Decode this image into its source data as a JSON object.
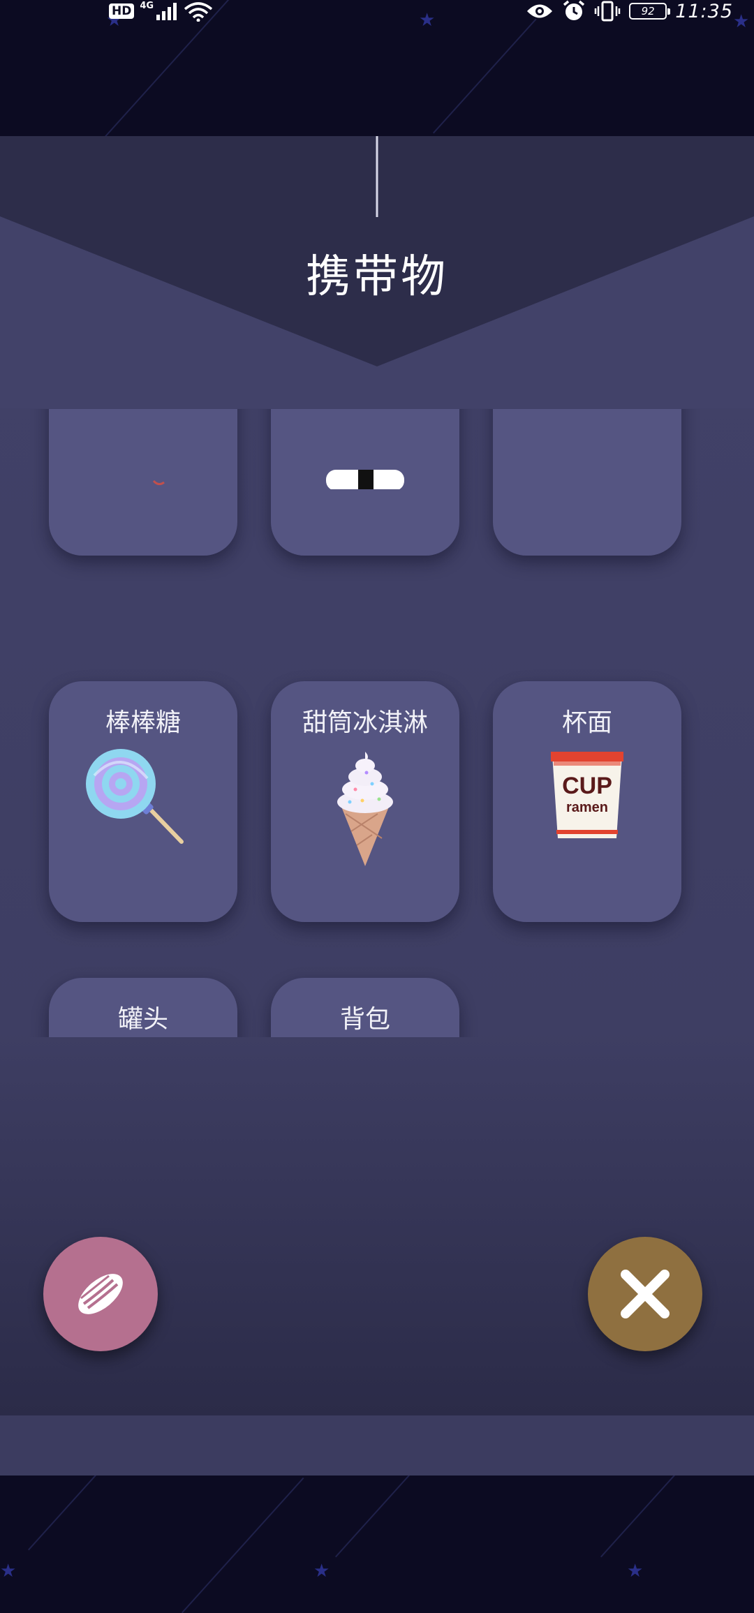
{
  "status_bar": {
    "hd_badge": "HD",
    "network": "4G",
    "battery": "92",
    "time": "11:35"
  },
  "modal": {
    "title": "携带物"
  },
  "items": [
    {
      "label": "",
      "icon": "partial-item-icon"
    },
    {
      "label": "",
      "icon": "partial-item-icon"
    },
    {
      "label": "",
      "icon": "partial-item-icon"
    },
    {
      "label": "棒棒糖",
      "icon": "lollipop-icon"
    },
    {
      "label": "甜筒冰淇淋",
      "icon": "ice-cream-cone-icon"
    },
    {
      "label": "杯面",
      "icon": "cup-ramen-icon"
    },
    {
      "label": "罐头",
      "icon": "canned-fish-icon"
    },
    {
      "label": "背包",
      "icon": "handbag-icon"
    }
  ],
  "cup_text": {
    "line1": "CUP",
    "line2": "ramen"
  },
  "actions": {
    "left": {
      "icon": "seed-icon",
      "color": "#b5708f"
    },
    "right": {
      "icon": "close-icon",
      "color": "#8f7040"
    }
  },
  "colors": {
    "background": "#0c0b22",
    "panel": "#424269",
    "card": "#555582"
  }
}
